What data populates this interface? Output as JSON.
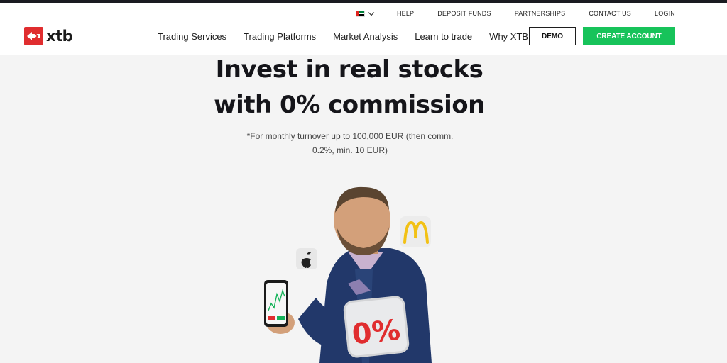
{
  "brand": {
    "name": "xtb",
    "logo_color": "#e02d2f"
  },
  "utility_nav": {
    "language_flag": "uae-flag-icon",
    "items": [
      "HELP",
      "DEPOSIT FUNDS",
      "PARTNERSHIPS",
      "CONTACT US",
      "LOGIN"
    ]
  },
  "main_nav": {
    "items": [
      "Trading Services",
      "Trading Platforms",
      "Market Analysis",
      "Learn to trade",
      "Why XTB"
    ]
  },
  "buttons": {
    "demo": "DEMO",
    "create_account": "CREATE ACCOUNT",
    "create_account_color": "#17c35a"
  },
  "hero": {
    "title_line1": "Invest in real stocks",
    "title_line2": "with 0% commission",
    "note_line1": "*For monthly turnover up to 100,000 EUR (then comm.",
    "note_line2": "0.2%, min. 10 EUR)"
  },
  "visual": {
    "badge_text": "0%",
    "icons": [
      "apple-logo-icon",
      "mcdonalds-logo-icon"
    ]
  }
}
